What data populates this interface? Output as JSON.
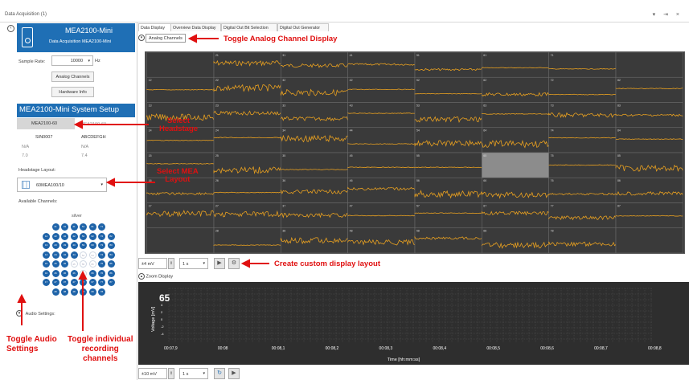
{
  "window": {
    "title": "Data Acquisition (1)",
    "controls": "▾ ⇥ ×"
  },
  "device": {
    "name": "MEA2100-Mini",
    "subtitle": "Data Acquisition   MEA2100-Mini"
  },
  "sample_rate": {
    "label": "Sample Rate:",
    "value": "10000",
    "unit": "Hz"
  },
  "buttons": {
    "analog_channels": "Analog Channels",
    "hardware_info": "Hardware Info"
  },
  "setup_title": "MEA2100-Mini System Setup",
  "headstages": {
    "col1": [
      "MEA2100-60",
      "SIN0007",
      "N/A",
      "7.0"
    ],
    "col2": [
      "MEA2100-60",
      "ABCDEFGH",
      "N/A",
      "7.4"
    ]
  },
  "headstage_layout": {
    "label": "Headstage Layout:",
    "value": "60MEA100/10"
  },
  "available_channels": {
    "label": "Available Channels:",
    "group": "silver"
  },
  "audio_settings": "Audio Settings:",
  "tabs": [
    "Data Display",
    "Overview Data Display",
    "Digital Out Bit Selection",
    "Digital Out Generator"
  ],
  "analog_channels_chip": "Analog Channels",
  "grid": {
    "rows": [
      [
        "",
        "21",
        "31",
        "41",
        "51",
        "61",
        "71",
        ""
      ],
      [
        "12",
        "22",
        "32",
        "42",
        "52",
        "62",
        "72",
        "82"
      ],
      [
        "13",
        "23",
        "33",
        "43",
        "53",
        "63",
        "73",
        "83"
      ],
      [
        "14",
        "24",
        "34",
        "44",
        "54",
        "64",
        "74",
        "84"
      ],
      [
        "15",
        "25",
        "35",
        "45",
        "55",
        "65",
        "75",
        "85"
      ],
      [
        "16",
        "26",
        "36",
        "46",
        "56",
        "66",
        "76",
        "86"
      ],
      [
        "17",
        "27",
        "37",
        "47",
        "57",
        "67",
        "77",
        "87"
      ],
      [
        "",
        "28",
        "38",
        "48",
        "58",
        "68",
        "78",
        ""
      ]
    ],
    "selected": "65",
    "trace_color": "#e8a020"
  },
  "controls": {
    "amp": "±4 mV",
    "time": "1 s"
  },
  "zoom": {
    "header": "Zoom Display",
    "channel": "65",
    "ylabel": "Voltage [mV]",
    "xlabel": "Time [hh:mm:ss]",
    "xticks": [
      "00:07,9",
      "00:08",
      "00:08,1",
      "00:08,2",
      "00:08,3",
      "00:08,4",
      "00:08,5",
      "00:08,6",
      "00:08,7",
      "00:08,8"
    ],
    "yticks": [
      "4",
      "2",
      "0",
      "-2",
      "-4"
    ]
  },
  "bottom": {
    "amp": "±10 mV",
    "time": "1 s"
  },
  "annotations": {
    "toggle_analog": "Toggle Analog Channel Display",
    "select_headstage": "Select\nHeadstage",
    "select_mea": "Select MEA\nLayout",
    "custom_layout": "Create custom display layout",
    "toggle_audio": "Toggle Audio\nSettings",
    "toggle_individual": "Toggle individual\nrecording\nchannels"
  }
}
